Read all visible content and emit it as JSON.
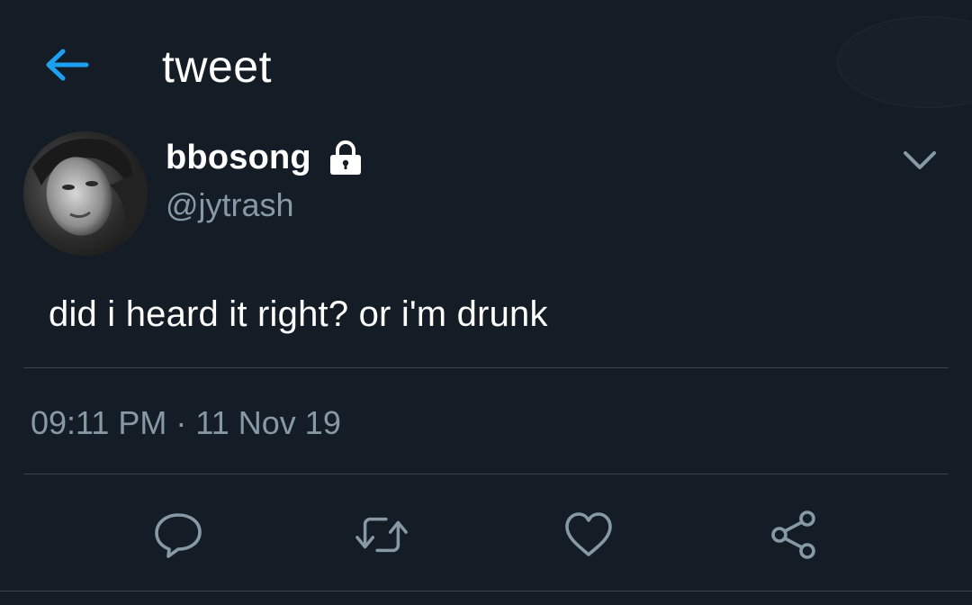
{
  "header": {
    "title": "tweet",
    "back_icon": "back-arrow-icon",
    "accent_color": "#1da1f2"
  },
  "tweet": {
    "display_name": "bbosong",
    "protected_icon": "lock-icon",
    "handle": "@jytrash",
    "text": "did i heard it right? or i'm drunk",
    "timestamp": "09:11 PM · 11 Nov 19",
    "menu_icon": "chevron-down-icon"
  },
  "actions": [
    {
      "name": "reply",
      "icon": "reply-icon"
    },
    {
      "name": "retweet",
      "icon": "retweet-icon"
    },
    {
      "name": "like",
      "icon": "heart-icon"
    },
    {
      "name": "share",
      "icon": "share-icon"
    }
  ],
  "colors": {
    "background": "#141d26",
    "secondary_text": "#8899a6",
    "divider": "#38444d",
    "icon_gray": "#8899a6"
  }
}
